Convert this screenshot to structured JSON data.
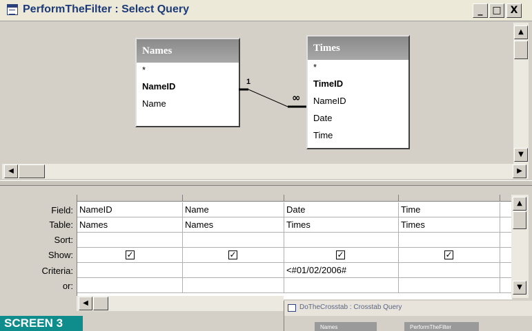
{
  "window": {
    "title": "PerformTheFilter : Select Query",
    "controls": {
      "minimize": "_",
      "maximize": "□",
      "close": "X"
    }
  },
  "design_tables": [
    {
      "name": "Names",
      "fields": [
        "*",
        "NameID",
        "Name"
      ],
      "key_field": "NameID"
    },
    {
      "name": "Times",
      "fields": [
        "*",
        "TimeID",
        "NameID",
        "Date",
        "Time"
      ],
      "key_field": "TimeID"
    }
  ],
  "relationship": {
    "one_side": "1",
    "many_side": "∞"
  },
  "grid": {
    "row_labels": [
      "Field:",
      "Table:",
      "Sort:",
      "Show:",
      "Criteria:",
      "or:"
    ],
    "columns": [
      {
        "field": "NameID",
        "table": "Names",
        "sort": "",
        "show": true,
        "criteria": "",
        "or": ""
      },
      {
        "field": "Name",
        "table": "Names",
        "sort": "",
        "show": true,
        "criteria": "",
        "or": ""
      },
      {
        "field": "Date",
        "table": "Times",
        "sort": "",
        "show": true,
        "criteria": "<#01/02/2006#",
        "or": ""
      },
      {
        "field": "Time",
        "table": "Times",
        "sort": "",
        "show": true,
        "criteria": "",
        "or": ""
      }
    ]
  },
  "second_window": {
    "title": "DoTheCrosstab : Crosstab Query",
    "tables": [
      "Names",
      "PerformTheFilter"
    ]
  },
  "caption": "SCREEN 3",
  "colors": {
    "caption_bg": "#0f8c8c",
    "title_text": "#1d3a78",
    "table_header": "#9a9a9a"
  }
}
